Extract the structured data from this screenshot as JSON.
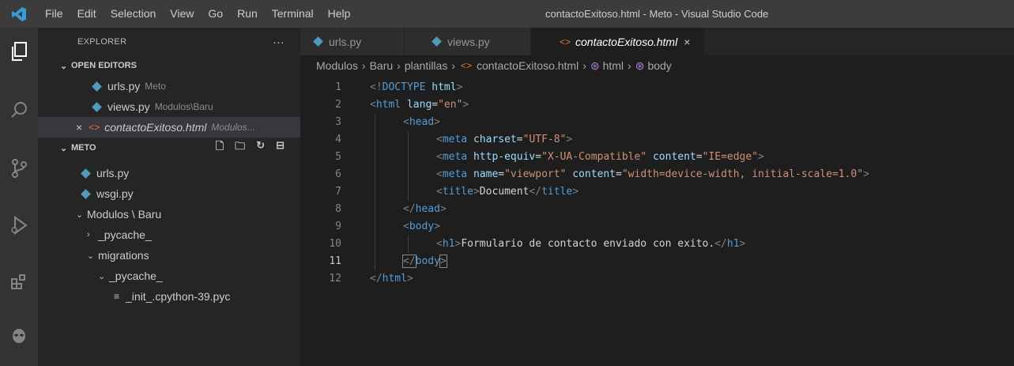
{
  "window": {
    "title": "contactoExitoso.html - Meto - Visual Studio Code",
    "menu": [
      "File",
      "Edit",
      "Selection",
      "View",
      "Go",
      "Run",
      "Terminal",
      "Help"
    ]
  },
  "activity_bar": [
    "explorer-icon",
    "search-icon",
    "source-control-icon",
    "run-debug-icon",
    "extensions-icon",
    "alien-icon"
  ],
  "sidebar": {
    "header": "EXPLORER",
    "header_more": "···",
    "open_editors": {
      "label": "OPEN EDITORS",
      "items": [
        {
          "name": "urls.py",
          "desc": "Meto",
          "icon": "python"
        },
        {
          "name": "views.py",
          "desc": "Modulos\\Baru",
          "icon": "python"
        },
        {
          "name": "contactoExitoso.html",
          "desc": "Modulos...",
          "icon": "html",
          "close": "×"
        }
      ]
    },
    "folder": {
      "label": "METO",
      "items": [
        {
          "name": "urls.py",
          "icon": "python"
        },
        {
          "name": "wsgi.py",
          "icon": "python"
        },
        {
          "name": "Modulos \\ Baru",
          "chev": "⌄"
        },
        {
          "name": "_pycache_",
          "chev": "›"
        },
        {
          "name": "migrations",
          "chev": "⌄"
        },
        {
          "name": "_pycache_",
          "chev": "⌄"
        },
        {
          "name": "_init_.cpython-39.pyc",
          "icon": "file"
        }
      ]
    }
  },
  "tabs": [
    {
      "label": "urls.py",
      "active": false
    },
    {
      "label": "views.py",
      "active": false
    },
    {
      "label": "contactoExitoso.html",
      "active": true,
      "close": "×"
    }
  ],
  "breadcrumb": [
    "Modulos",
    "Baru",
    "plantillas",
    "contactoExitoso.html",
    "html",
    "body"
  ],
  "editor": {
    "current_line": 11,
    "lines": [
      {
        "n": "1",
        "tokens": [
          [
            "br",
            "<!"
          ],
          [
            "tag",
            "DOCTYPE"
          ],
          [
            "txt",
            " "
          ],
          [
            "attr",
            "html"
          ],
          [
            "br",
            ">"
          ]
        ],
        "indent": 0
      },
      {
        "n": "2",
        "tokens": [
          [
            "br",
            "<"
          ],
          [
            "tag",
            "html"
          ],
          [
            "txt",
            " "
          ],
          [
            "attr",
            "lang"
          ],
          [
            "txt",
            "="
          ],
          [
            "str",
            "\"en\""
          ],
          [
            "br",
            ">"
          ]
        ],
        "indent": 0
      },
      {
        "n": "3",
        "tokens": [
          [
            "br",
            "<"
          ],
          [
            "tag",
            "head"
          ],
          [
            "br",
            ">"
          ]
        ],
        "indent": 1
      },
      {
        "n": "4",
        "tokens": [
          [
            "br",
            "<"
          ],
          [
            "tag",
            "meta"
          ],
          [
            "txt",
            " "
          ],
          [
            "attr",
            "charset"
          ],
          [
            "txt",
            "="
          ],
          [
            "str",
            "\"UTF-8\""
          ],
          [
            "br",
            ">"
          ]
        ],
        "indent": 2
      },
      {
        "n": "5",
        "tokens": [
          [
            "br",
            "<"
          ],
          [
            "tag",
            "meta"
          ],
          [
            "txt",
            " "
          ],
          [
            "attr",
            "http-equiv"
          ],
          [
            "txt",
            "="
          ],
          [
            "str",
            "\"X-UA-Compatible\""
          ],
          [
            "txt",
            " "
          ],
          [
            "attr",
            "content"
          ],
          [
            "txt",
            "="
          ],
          [
            "str",
            "\"IE=edge\""
          ],
          [
            "br",
            ">"
          ]
        ],
        "indent": 2
      },
      {
        "n": "6",
        "tokens": [
          [
            "br",
            "<"
          ],
          [
            "tag",
            "meta"
          ],
          [
            "txt",
            " "
          ],
          [
            "attr",
            "name"
          ],
          [
            "txt",
            "="
          ],
          [
            "str",
            "\"viewport\""
          ],
          [
            "txt",
            " "
          ],
          [
            "attr",
            "content"
          ],
          [
            "txt",
            "="
          ],
          [
            "str",
            "\"width=device-width, initial-scale=1.0\""
          ],
          [
            "br",
            ">"
          ]
        ],
        "indent": 2
      },
      {
        "n": "7",
        "tokens": [
          [
            "br",
            "<"
          ],
          [
            "tag",
            "title"
          ],
          [
            "br",
            ">"
          ],
          [
            "txt",
            "Document"
          ],
          [
            "br",
            "</"
          ],
          [
            "tag",
            "title"
          ],
          [
            "br",
            ">"
          ]
        ],
        "indent": 2
      },
      {
        "n": "8",
        "tokens": [
          [
            "br",
            "</"
          ],
          [
            "tag",
            "head"
          ],
          [
            "br",
            ">"
          ]
        ],
        "indent": 1
      },
      {
        "n": "9",
        "tokens": [
          [
            "br",
            "<"
          ],
          [
            "tag",
            "body"
          ],
          [
            "br",
            ">"
          ]
        ],
        "indent": 1
      },
      {
        "n": "10",
        "tokens": [
          [
            "br",
            "<"
          ],
          [
            "tag",
            "h1"
          ],
          [
            "br",
            ">"
          ],
          [
            "txt",
            "Formulario de contacto enviado con exito."
          ],
          [
            "br",
            "</"
          ],
          [
            "tag",
            "h1"
          ],
          [
            "br",
            ">"
          ]
        ],
        "indent": 2
      },
      {
        "n": "11",
        "tokens": [
          [
            "br",
            "</"
          ],
          [
            "tag",
            "body"
          ],
          [
            "br",
            ">"
          ]
        ],
        "indent": 1
      },
      {
        "n": "12",
        "tokens": [
          [
            "br",
            "</"
          ],
          [
            "tag",
            "html"
          ],
          [
            "br",
            ">"
          ]
        ],
        "indent": 0
      }
    ]
  }
}
